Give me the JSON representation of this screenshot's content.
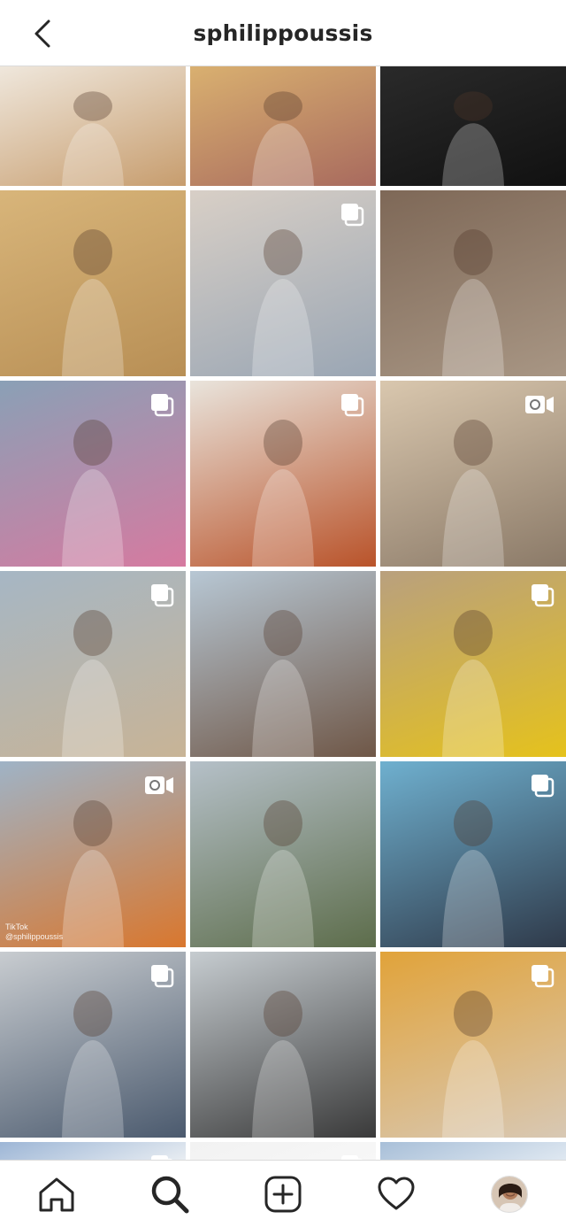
{
  "header": {
    "username": "sphilippoussis"
  },
  "icons": {
    "back": "chevron-left-icon",
    "home": "home-icon",
    "search": "search-icon",
    "new_post": "add-post-icon",
    "activity": "heart-icon",
    "profile": "profile-avatar"
  },
  "grid": {
    "posts": [
      {
        "kind": "photo",
        "bg": [
          "#efe7dc",
          "#c79d6e"
        ]
      },
      {
        "kind": "photo",
        "bg": [
          "#d9b070",
          "#a86a5e"
        ]
      },
      {
        "kind": "photo",
        "bg": [
          "#2a2a2a",
          "#111111"
        ]
      },
      {
        "kind": "photo",
        "bg": [
          "#d8b57a",
          "#b88f55"
        ]
      },
      {
        "kind": "carousel",
        "bg": [
          "#d8cfc6",
          "#9aa6b4"
        ]
      },
      {
        "kind": "photo",
        "bg": [
          "#7e6857",
          "#a89684"
        ]
      },
      {
        "kind": "carousel",
        "bg": [
          "#8aa0b6",
          "#d67aa0"
        ]
      },
      {
        "kind": "carousel",
        "bg": [
          "#e9e4dc",
          "#b9532a"
        ]
      },
      {
        "kind": "video",
        "bg": [
          "#d9c7ae",
          "#8b7a68"
        ]
      },
      {
        "kind": "carousel",
        "bg": [
          "#a6b6c4",
          "#c8b496"
        ]
      },
      {
        "kind": "photo",
        "bg": [
          "#b7c7d4",
          "#6f5747"
        ]
      },
      {
        "kind": "carousel",
        "bg": [
          "#b9a07e",
          "#e5c21c"
        ]
      },
      {
        "kind": "video",
        "bg": [
          "#9fb3c6",
          "#d9772e"
        ],
        "overlay_text": [
          "TikTok",
          "@sphilippoussis"
        ]
      },
      {
        "kind": "photo",
        "bg": [
          "#b5c0c8",
          "#5d6d4b"
        ]
      },
      {
        "kind": "carousel",
        "bg": [
          "#6fb0cf",
          "#2f3a4a"
        ]
      },
      {
        "kind": "carousel",
        "bg": [
          "#c8ccd0",
          "#4b5a6e"
        ]
      },
      {
        "kind": "photo",
        "bg": [
          "#c6ccd0",
          "#3a3a3a"
        ]
      },
      {
        "kind": "carousel",
        "bg": [
          "#e1a33a",
          "#d8c8b4"
        ]
      },
      {
        "kind": "carousel",
        "bg": [
          "#9db6d6",
          "#e8edf2"
        ]
      },
      {
        "kind": "carousel",
        "bg": [
          "#f2f2f2",
          "#f7f7f7"
        ]
      },
      {
        "kind": "photo",
        "bg": [
          "#a8bfd8",
          "#dfe8f1"
        ]
      }
    ]
  },
  "colors": {
    "text": "#262626",
    "border": "#dbdbdb",
    "background": "#ffffff"
  }
}
